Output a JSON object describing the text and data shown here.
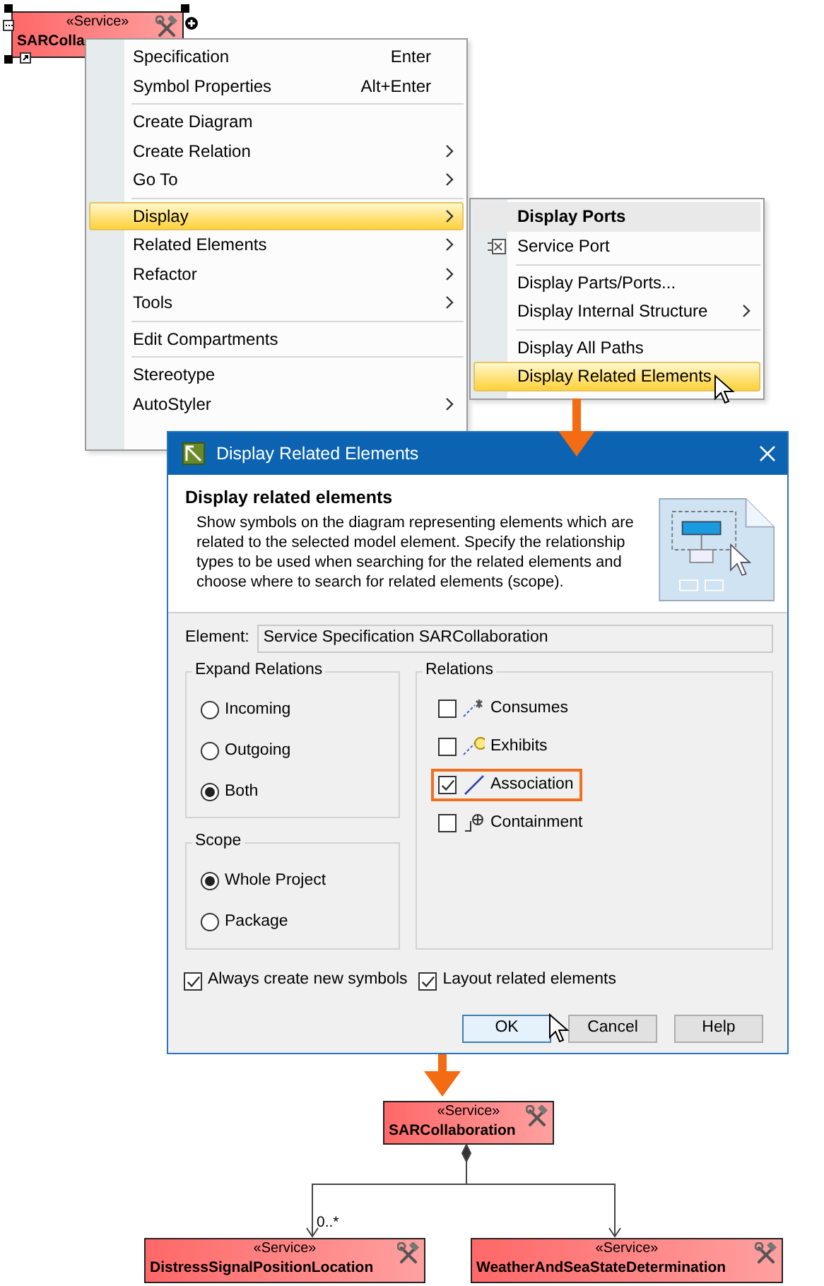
{
  "source_node": {
    "stereotype": "«Service»",
    "name": "SARColla",
    "selected": true
  },
  "context_menu": {
    "items": [
      {
        "kind": "item",
        "label": "Specification",
        "shortcut": "Enter",
        "submenu": false,
        "selected": false,
        "disabled": false
      },
      {
        "kind": "item",
        "label": "Symbol Properties",
        "shortcut": "Alt+Enter",
        "submenu": false,
        "selected": false,
        "disabled": false
      },
      {
        "kind": "separator"
      },
      {
        "kind": "item",
        "label": "Create Diagram",
        "submenu": false,
        "selected": false,
        "disabled": false
      },
      {
        "kind": "item",
        "label": "Create Relation",
        "submenu": true,
        "selected": false,
        "disabled": false
      },
      {
        "kind": "item",
        "label": "Go To",
        "submenu": true,
        "selected": false,
        "disabled": false
      },
      {
        "kind": "separator"
      },
      {
        "kind": "item",
        "label": "Display",
        "submenu": true,
        "selected": true,
        "disabled": false
      },
      {
        "kind": "item",
        "label": "Related Elements",
        "submenu": true,
        "selected": false,
        "disabled": false
      },
      {
        "kind": "item",
        "label": "Refactor",
        "submenu": true,
        "selected": false,
        "disabled": false
      },
      {
        "kind": "item",
        "label": "Tools",
        "submenu": true,
        "selected": false,
        "disabled": false
      },
      {
        "kind": "separator"
      },
      {
        "kind": "item",
        "label": "Edit Compartments",
        "submenu": false,
        "selected": false,
        "disabled": false
      },
      {
        "kind": "separator"
      },
      {
        "kind": "item",
        "label": "Stereotype",
        "submenu": false,
        "selected": false,
        "disabled": false
      },
      {
        "kind": "item",
        "label": "AutoStyler",
        "submenu": true,
        "selected": false,
        "disabled": false
      }
    ]
  },
  "display_submenu": {
    "items": [
      {
        "kind": "header",
        "label": "Display Ports"
      },
      {
        "kind": "port",
        "label": "Service Port",
        "submenu": false,
        "selected": false
      },
      {
        "kind": "separator"
      },
      {
        "kind": "item",
        "label": "Display Parts/Ports...",
        "submenu": false,
        "selected": false
      },
      {
        "kind": "item",
        "label": "Display Internal Structure",
        "submenu": true,
        "selected": false
      },
      {
        "kind": "separator"
      },
      {
        "kind": "item",
        "label": "Display All Paths",
        "submenu": false,
        "selected": false
      },
      {
        "kind": "item",
        "label": "Display Related Elements",
        "submenu": false,
        "selected": true
      }
    ]
  },
  "dialog": {
    "title": "Display Related Elements",
    "heading": "Display related elements",
    "description": "Show symbols on the diagram representing elements which are related to the selected model element. Specify the relationship types to be used when searching for the related elements and choose where to search for related elements (scope).",
    "element_label": "Element:",
    "element_value": "Service Specification SARCollaboration",
    "expand_relations": {
      "title": "Expand Relations",
      "options": [
        {
          "label": "Incoming",
          "selected": false
        },
        {
          "label": "Outgoing",
          "selected": false
        },
        {
          "label": "Both",
          "selected": true
        }
      ]
    },
    "scope": {
      "title": "Scope",
      "options": [
        {
          "label": "Whole Project",
          "selected": true
        },
        {
          "label": "Package",
          "selected": false
        }
      ]
    },
    "relations": {
      "title": "Relations",
      "items": [
        {
          "kind": "consumes",
          "label": "Consumes",
          "checked": false,
          "highlighted": false
        },
        {
          "kind": "exhibits",
          "label": "Exhibits",
          "checked": false,
          "highlighted": false
        },
        {
          "kind": "association",
          "label": "Association",
          "checked": true,
          "highlighted": true
        },
        {
          "kind": "containment",
          "label": "Containment",
          "checked": false,
          "highlighted": false
        }
      ]
    },
    "options": [
      {
        "label": "Always create new symbols",
        "checked": true
      },
      {
        "label": "Layout related elements",
        "checked": true
      }
    ],
    "buttons": [
      {
        "label": "OK",
        "focused": true
      },
      {
        "label": "Cancel",
        "focused": false
      },
      {
        "label": "Help",
        "focused": false
      }
    ]
  },
  "result_diagram": {
    "root": {
      "stereotype": "«Service»",
      "name": "SARCollaboration"
    },
    "children": [
      {
        "stereotype": "«Service»",
        "name": "DistressSignalPositionLocation",
        "multiplicity": "0..*"
      },
      {
        "stereotype": "«Service»",
        "name": "WeatherAndSeaStateDetermination"
      }
    ]
  }
}
